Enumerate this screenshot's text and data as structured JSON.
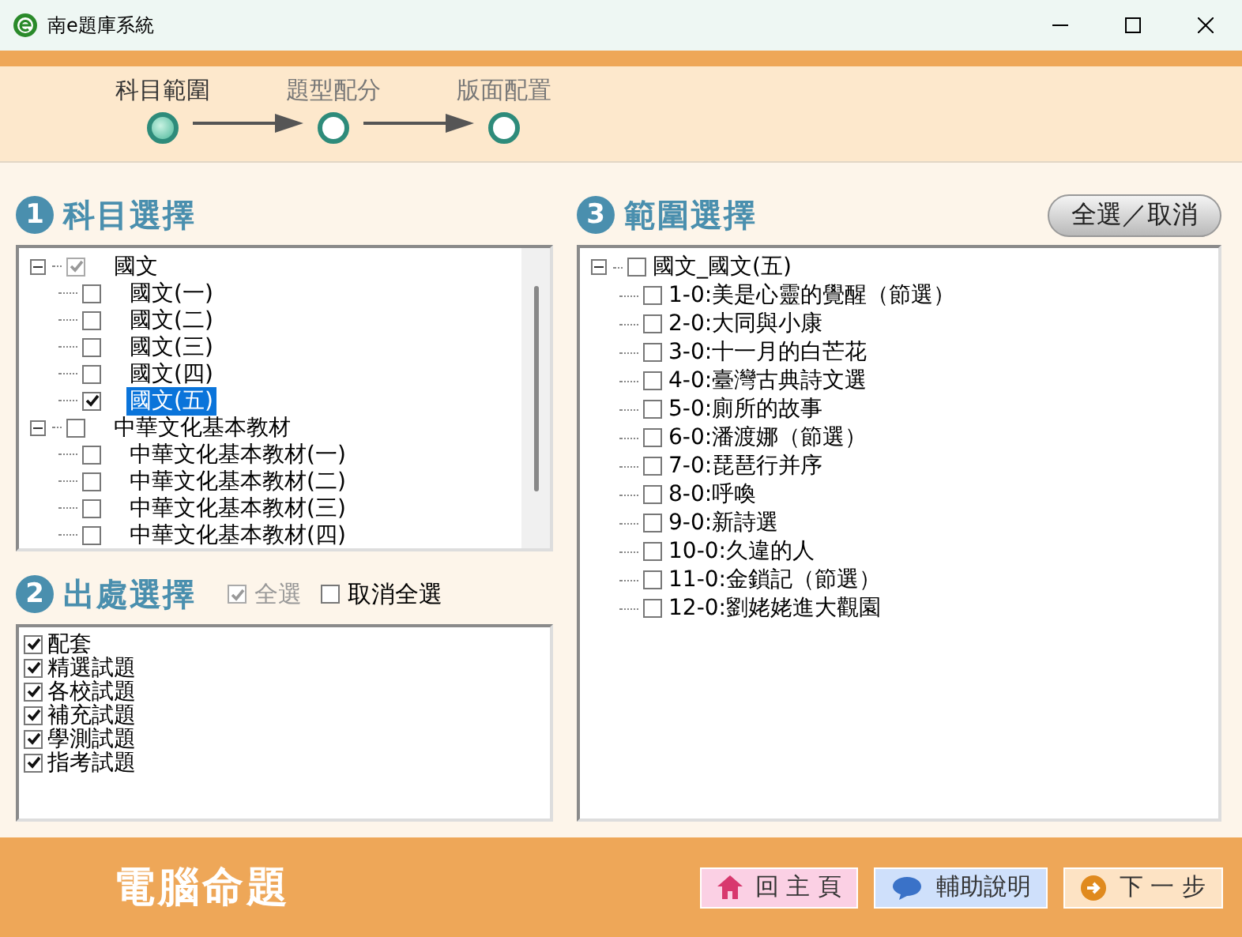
{
  "window": {
    "title": "南e題庫系統"
  },
  "steps": [
    {
      "label": "科目範圍",
      "selected": true
    },
    {
      "label": "題型配分",
      "selected": false
    },
    {
      "label": "版面配置",
      "selected": false
    }
  ],
  "subject_panel": {
    "number": "1",
    "title": "科目選擇",
    "tree": [
      {
        "label": "國文",
        "checked": true,
        "partial": true,
        "expanded": true,
        "selected": false,
        "children": [
          {
            "label": "國文(一)",
            "checked": false,
            "selected": false
          },
          {
            "label": "國文(二)",
            "checked": false,
            "selected": false
          },
          {
            "label": "國文(三)",
            "checked": false,
            "selected": false
          },
          {
            "label": "國文(四)",
            "checked": false,
            "selected": false
          },
          {
            "label": "國文(五)",
            "checked": true,
            "selected": true
          }
        ]
      },
      {
        "label": "中華文化基本教材",
        "checked": false,
        "expanded": true,
        "selected": false,
        "children": [
          {
            "label": "中華文化基本教材(一)",
            "checked": false,
            "selected": false
          },
          {
            "label": "中華文化基本教材(二)",
            "checked": false,
            "selected": false
          },
          {
            "label": "中華文化基本教材(三)",
            "checked": false,
            "selected": false
          },
          {
            "label": "中華文化基本教材(四)",
            "checked": false,
            "selected": false
          }
        ]
      }
    ]
  },
  "source_panel": {
    "number": "2",
    "title": "出處選擇",
    "select_all": {
      "label": "全選",
      "checked": true,
      "disabled": true
    },
    "clear_all": {
      "label": "取消全選",
      "checked": false,
      "disabled": false
    },
    "items": [
      {
        "label": "配套",
        "checked": true
      },
      {
        "label": "精選試題",
        "checked": true
      },
      {
        "label": "各校試題",
        "checked": true
      },
      {
        "label": "補充試題",
        "checked": true
      },
      {
        "label": "學測試題",
        "checked": true
      },
      {
        "label": "指考試題",
        "checked": true
      }
    ]
  },
  "range_panel": {
    "number": "3",
    "title": "範圍選擇",
    "toggle_button": "全選／取消",
    "tree": [
      {
        "label": "國文_國文(五)",
        "checked": false,
        "expanded": true,
        "children": [
          {
            "label": "1-0:美是心靈的覺醒（節選）",
            "checked": false
          },
          {
            "label": "2-0:大同與小康",
            "checked": false
          },
          {
            "label": "3-0:十一月的白芒花",
            "checked": false
          },
          {
            "label": "4-0:臺灣古典詩文選",
            "checked": false
          },
          {
            "label": "5-0:廁所的故事",
            "checked": false
          },
          {
            "label": "6-0:潘渡娜（節選）",
            "checked": false
          },
          {
            "label": "7-0:琵琶行并序",
            "checked": false
          },
          {
            "label": "8-0:呼喚",
            "checked": false
          },
          {
            "label": "9-0:新詩選",
            "checked": false
          },
          {
            "label": "10-0:久違的人",
            "checked": false
          },
          {
            "label": "11-0:金鎖記（節選）",
            "checked": false
          },
          {
            "label": "12-0:劉姥姥進大觀園",
            "checked": false
          }
        ]
      }
    ]
  },
  "footer": {
    "title": "電腦命題",
    "buttons": [
      {
        "label": "回 主 頁",
        "kind": "home"
      },
      {
        "label": "輔助說明",
        "kind": "help"
      },
      {
        "label": "下 一 步",
        "kind": "next"
      }
    ]
  }
}
